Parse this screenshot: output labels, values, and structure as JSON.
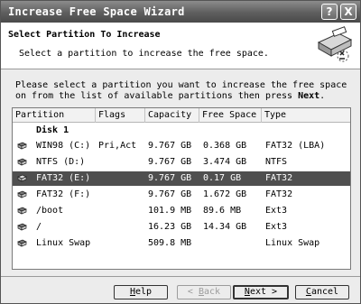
{
  "window": {
    "title": "Increase Free Space Wizard",
    "help_glyph": "?",
    "close_glyph": "X"
  },
  "header": {
    "title": "Select Partition To Increase",
    "subtitle": "Select a partition to increase the free space."
  },
  "intro": {
    "text": "Please select a partition you want to increase the free space on from the list of available partitions then press",
    "bold_word": "Next",
    "end": "."
  },
  "list": {
    "columns": [
      "Partition",
      "Flags",
      "Capacity",
      "Free Space",
      "Type"
    ],
    "disk_label": "Disk 1",
    "rows": [
      {
        "partition": "WIN98 (C:)",
        "flags": "Pri,Act",
        "capacity": "9.767 GB",
        "free": "0.368 GB",
        "type": "FAT32 (LBA)"
      },
      {
        "partition": "NTFS (D:)",
        "flags": "",
        "capacity": "9.767 GB",
        "free": "3.474 GB",
        "type": "NTFS"
      },
      {
        "partition": "FAT32 (E:)",
        "flags": "",
        "capacity": "9.767 GB",
        "free": "0.17 GB",
        "type": "FAT32"
      },
      {
        "partition": "FAT32 (F:)",
        "flags": "",
        "capacity": "9.767 GB",
        "free": "1.672 GB",
        "type": "FAT32"
      },
      {
        "partition": "/boot",
        "flags": "",
        "capacity": "101.9 MB",
        "free": "89.6 MB",
        "type": "Ext3"
      },
      {
        "partition": "/",
        "flags": "",
        "capacity": "16.23 GB",
        "free": "14.34 GB",
        "type": "Ext3"
      },
      {
        "partition": "Linux Swap",
        "flags": "",
        "capacity": "509.8 MB",
        "free": "",
        "type": "Linux Swap"
      }
    ],
    "selected_index": 2
  },
  "buttons": {
    "help": {
      "mnemonic": "H",
      "rest": "elp"
    },
    "back": {
      "prefix": "< ",
      "mnemonic": "B",
      "rest": "ack"
    },
    "next": {
      "mnemonic": "N",
      "rest": "ext >"
    },
    "cancel": {
      "mnemonic": "C",
      "rest": "ancel"
    }
  },
  "icons": {
    "wizard": "partition-wizard-icon",
    "drive": "hard-drive-icon"
  }
}
